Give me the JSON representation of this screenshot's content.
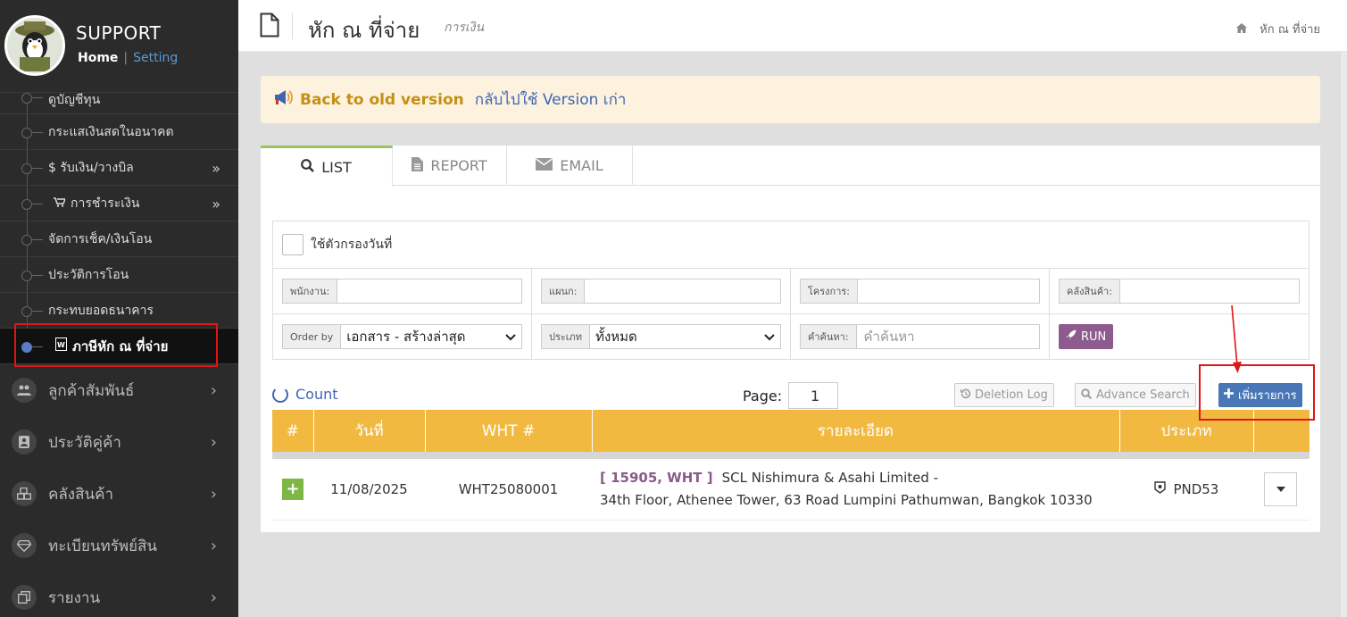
{
  "sidebar": {
    "brand": "SUPPORT",
    "home": "Home",
    "sep": "|",
    "setting": "Setting",
    "sub_items": [
      {
        "label": "ดูบัญชีทุน"
      },
      {
        "label": "กระแสเงินสดในอนาคต"
      },
      {
        "label": "$ รับเงิน/วางบิล",
        "chevron": "»"
      },
      {
        "label": "การชำระเงิน",
        "chevron": "»"
      },
      {
        "label": "จัดการเช็ค/เงินโอน"
      },
      {
        "label": "ประวัติการโอน"
      },
      {
        "label": "กระทบยอดธนาคาร"
      },
      {
        "label": "ภาษีหัก ณ ที่จ่าย"
      }
    ],
    "main_items": [
      {
        "label": "ลูกค้าสัมพันธ์",
        "chevron": "›"
      },
      {
        "label": "ประวัติคู่ค้า",
        "chevron": "›"
      },
      {
        "label": "คลังสินค้า",
        "chevron": "›"
      },
      {
        "label": "ทะเบียนทรัพย์สิน",
        "chevron": "›"
      },
      {
        "label": "รายงาน",
        "chevron": "›"
      }
    ]
  },
  "header": {
    "title": "หัก ณ ที่จ่าย",
    "subtitle": "การเงิน",
    "breadcrumb": "หัก ณ ที่จ่าย"
  },
  "alert": {
    "back_label": "Back to old version",
    "revert_label": "กลับไปใช้ Version เก่า"
  },
  "tabs": [
    {
      "label": "LIST"
    },
    {
      "label": "REPORT"
    },
    {
      "label": "EMAIL"
    }
  ],
  "filters": {
    "date_filter_label": "ใช้ตัวกรองวันที่",
    "employee_label": "พนักงาน:",
    "employee_value": "",
    "department_label": "แผนก:",
    "department_value": "",
    "project_label": "โครงการ:",
    "project_value": "",
    "warehouse_label": "คลังสินค้า:",
    "warehouse_value": "",
    "order_by_label": "Order by",
    "order_by_value": "เอกสาร - สร้างล่าสุด",
    "type_label": "ประเภท",
    "type_value": "ทั้งหมด",
    "search_label": "คำค้นหา:",
    "search_placeholder": "คำค้นหา",
    "run_label": "RUN"
  },
  "toolbar": {
    "count_label": "Count",
    "page_label": "Page:",
    "page_value": "1",
    "deletion_log_label": "Deletion Log",
    "advance_search_label": "Advance Search",
    "add_label": "เพิ่มรายการ"
  },
  "table": {
    "headers": [
      "#",
      "วันที่",
      "WHT #",
      "รายละเอียด",
      "ประเภท",
      ""
    ],
    "rows": [
      {
        "date": "11/08/2025",
        "wht_no": "WHT25080001",
        "tag": "[ 15905, WHT ]",
        "company": "SCL Nishimura & Asahi Limited -",
        "address": "34th Floor, Athenee Tower, 63 Road Lumpini Pathumwan, Bangkok 10330",
        "type": "PND53"
      }
    ]
  },
  "colors": {
    "sidebar_bg": "#2b2b2b",
    "table_header": "#f2b941",
    "accent_blue": "#4876b7",
    "run_purple": "#8e5b8e",
    "annotation_red": "#e01515"
  }
}
